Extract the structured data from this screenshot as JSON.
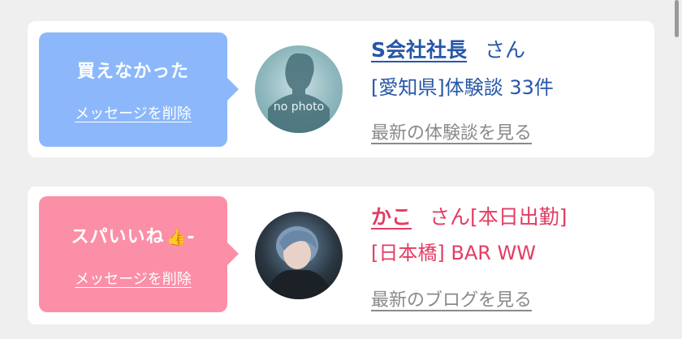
{
  "cards": [
    {
      "message": "買えなかった",
      "delete_label": "メッセージを削除",
      "name": "S会社社長",
      "honorific": "さん",
      "location": "[愛知県]体験談 33件",
      "link_label": "最新の体験談を見る",
      "avatar_text": "no photo",
      "accent_color": "#2757a8",
      "bubble_color": "#8cb8fb"
    },
    {
      "message": "スパいいね",
      "message_suffix": "-",
      "delete_label": "メッセージを削除",
      "name": "かこ",
      "honorific": "さん[本日出勤]",
      "location": "[日本橋] BAR WW",
      "link_label": "最新のブログを見る",
      "accent_color": "#e23d63",
      "bubble_color": "#fb8fa7"
    }
  ]
}
